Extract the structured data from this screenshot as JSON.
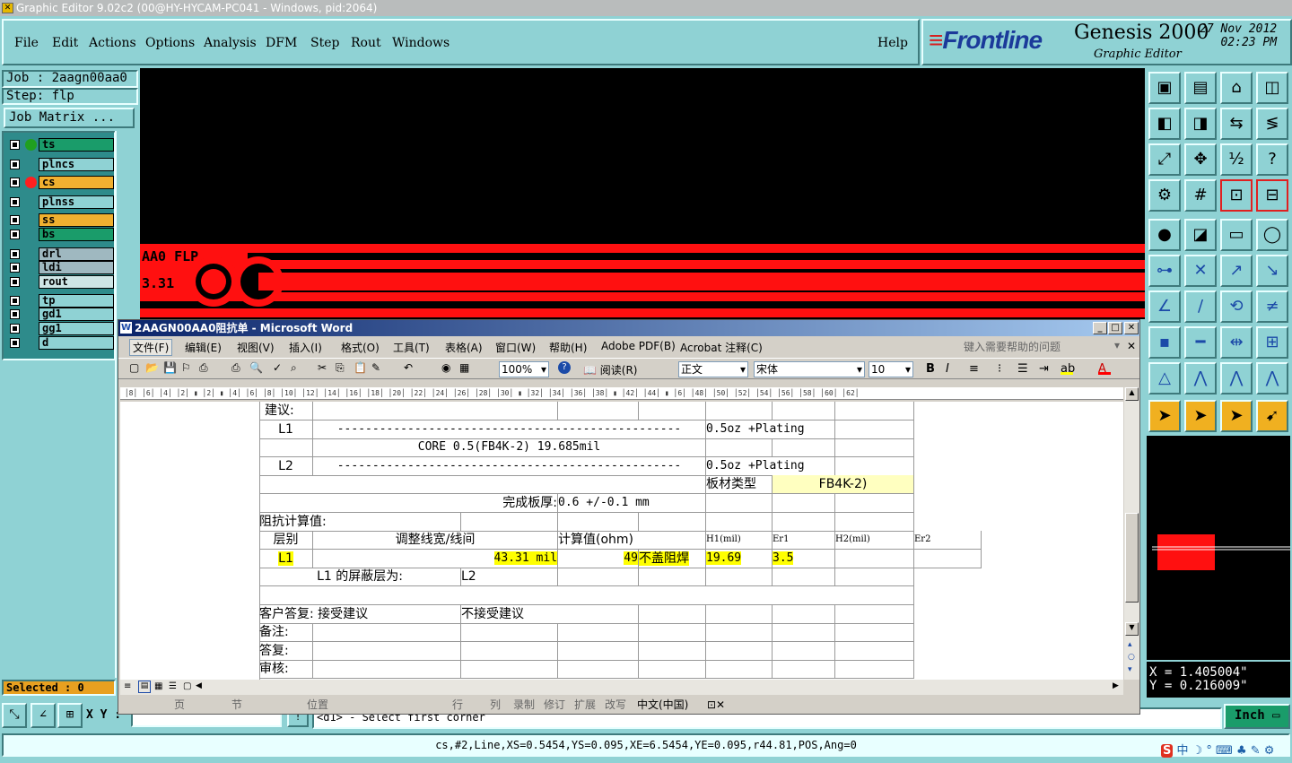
{
  "app": {
    "title": "Graphic Editor 9.02c2 (00@HY-HYCAM-PC041 - Windows, pid:2064)"
  },
  "menubar": {
    "items": [
      "File",
      "Edit",
      "Actions",
      "Options",
      "Analysis",
      "DFM",
      "Step",
      "Rout",
      "Windows"
    ],
    "help": "Help"
  },
  "brand": {
    "logo": "Frontline",
    "product": "Genesis 2000",
    "subtitle": "Graphic Editor",
    "date": "27 Nov 2012",
    "time": "02:23 PM"
  },
  "job": {
    "job_label": "Job : 2aagn00aa0",
    "step_label": "Step: flp",
    "matrix_button": "Job Matrix ..."
  },
  "layers": [
    {
      "name": "ts",
      "color": "#1a9c6a",
      "dot": "#20a020"
    },
    {
      "name": "plncs",
      "color": "#8fd2d4",
      "dot": ""
    },
    {
      "name": "cs",
      "color": "#f0b030",
      "dot": "#ff2020"
    },
    {
      "name": "plnss",
      "color": "#8fd2d4",
      "dot": ""
    },
    {
      "name": "ss",
      "color": "#f0b030",
      "dot": ""
    },
    {
      "name": "bs",
      "color": "#1a9c6a",
      "dot": ""
    },
    {
      "name": "drl",
      "color": "#9fb8c0",
      "dot": ""
    },
    {
      "name": "ldi",
      "color": "#9fb8c0",
      "dot": ""
    },
    {
      "name": "rout",
      "color": "#cfe6e6",
      "dot": ""
    },
    {
      "name": "tp",
      "color": "#8fd2d4",
      "dot": ""
    },
    {
      "name": "gd1",
      "color": "#8fd2d4",
      "dot": ""
    },
    {
      "name": "gg1",
      "color": "#8fd2d4",
      "dot": ""
    },
    {
      "name": "d",
      "color": "#8fd2d4",
      "dot": ""
    }
  ],
  "selected": "Selected : 0",
  "canvas": {
    "text1": "AA0 FLP",
    "text2": "3.31"
  },
  "coords": {
    "x": "X = 1.405004\"",
    "y": "Y = 0.216009\""
  },
  "word": {
    "title": "2AAGN00AA0阻抗单 - Microsoft Word",
    "menu": [
      "文件(F)",
      "编辑(E)",
      "视图(V)",
      "插入(I)",
      "格式(O)",
      "工具(T)",
      "表格(A)",
      "窗口(W)",
      "帮助(H)",
      "Adobe PDF(B)",
      "Acrobat 注释(C)"
    ],
    "help_placeholder": "键入需要帮助的问题",
    "zoom": "100%",
    "read_button": "阅读(R)",
    "style": "正文",
    "font": "宋体",
    "font_size": "10",
    "statusbar": [
      "页",
      "节",
      "位置",
      "行",
      "列",
      "录制",
      "修订",
      "扩展",
      "改写",
      "中文(中国)"
    ]
  },
  "doc": {
    "r_suggest": "建议:",
    "r_l1": "L1",
    "dashes": "-------------------------------------------------",
    "plating": "0.5oz +Plating",
    "core": "CORE  0.5(FB4K-2) 19.685mil",
    "r_l2": "L2",
    "board_type": "板材类型",
    "board_val": "FB4K-2)",
    "thickness_label": "完成板厚:",
    "thickness_val": "0.6 +/-0.1 mm",
    "imp_title": "阻抗计算值:",
    "h_layer": "层别",
    "h_adjust": "调整线宽/线间",
    "h_calc": "计算值(ohm)",
    "h_h1": "H1(mil)",
    "h_er1": "Er1",
    "h_h2": "H2(mil)",
    "h_er2": "Er2",
    "d_layer": "L1",
    "d_width": "43.31 mil",
    "d_calc": "49",
    "d_note": "不盖阻焊",
    "d_h1": "19.69",
    "d_er1": "3.5",
    "shield": "L1  的屏蔽层为:",
    "shield_val": "L2",
    "reply": "客户答复:   接受建议",
    "reject": "不接受建议",
    "remark": "备注:",
    "answer": "答复:",
    "review": "审核:"
  },
  "cmd": {
    "xy_label": "X Y :",
    "prompt": "<d1> - Select first corner",
    "unit": "Inch"
  },
  "status_line": "cs,#2,Line,XS=0.5454,YS=0.095,XE=6.5454,YE=0.095,r44.81,POS,Ang=0"
}
